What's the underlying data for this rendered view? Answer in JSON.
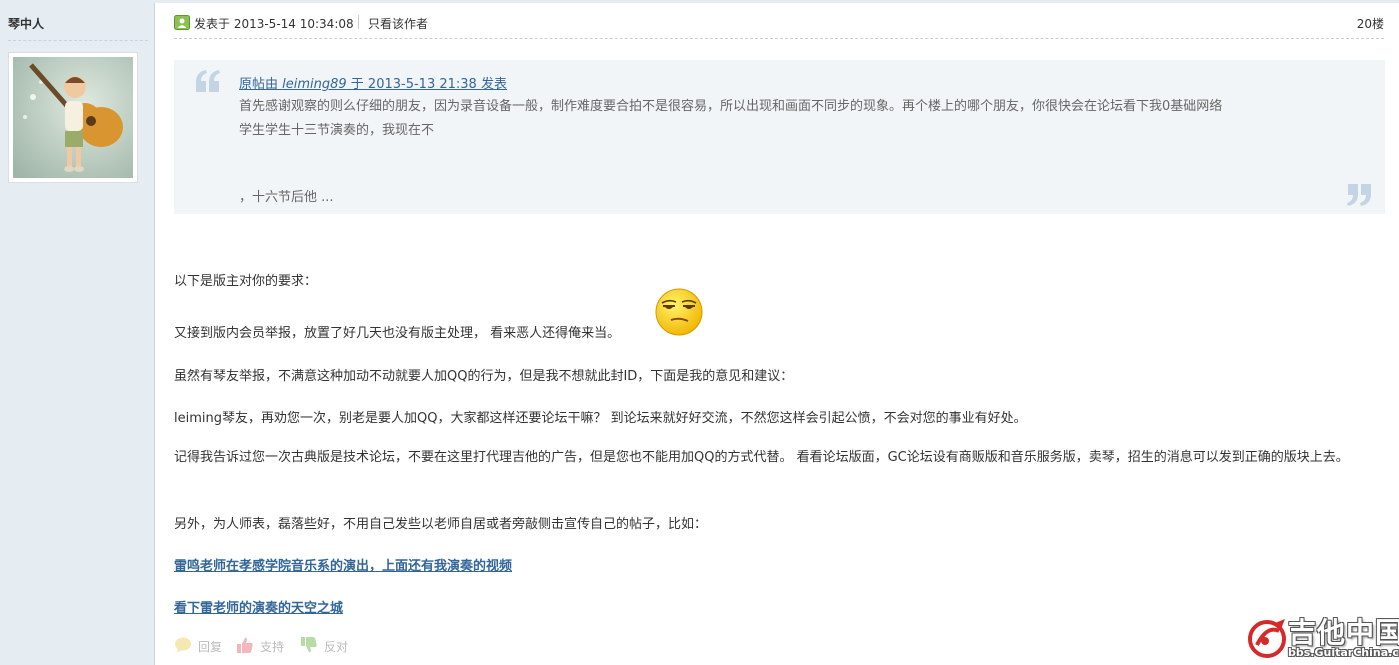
{
  "author": {
    "name": "琴中人",
    "avatar_icon": "guitar-boy-avatar"
  },
  "post_header": {
    "online_icon": "online-status-icon",
    "time": "发表于 2013-5-14 10:34:08",
    "only_author": "只看该作者",
    "floor": "20楼"
  },
  "quote": {
    "source_prefix": "原帖由 ",
    "source_author": "leiming89",
    "source_suffix": " 于 2013-5-13 21:38 发表",
    "line1": "首先感谢观察的则么仔细的朋友，因为录音设备一般，制作难度要合拍不是很容易，所以出现和画面不同步的现象。再个楼上的哪个朋友，你很快会在论坛看下我0基础网络",
    "line2": "学生学生十三节演奏的，我现在不",
    "line3": "，十六节后他 ..."
  },
  "content": {
    "p1": "以下是版主对你的要求：",
    "p2": "又接到版内会员举报，放置了好几天也没有版主处理， 看来恶人还得俺来当。",
    "p3": "虽然有琴友举报，不满意这种加动不动就要人加QQ的行为，但是我不想就此封ID，下面是我的意见和建议：",
    "p4": "leiming琴友，再劝您一次，别老是要人加QQ，大家都这样还要论坛干嘛？ 到论坛来就好好交流，不然您这样会引起公愤，不会对您的事业有好处。",
    "p5": "记得我告诉过您一次古典版是技术论坛，不要在这里打代理吉他的广告，但是您也不能用加QQ的方式代替。 看看论坛版面，GC论坛设有商贩版和音乐服务版，卖琴，招生的消息可以发到正确的版块上去。",
    "p6": "另外，为人师表，磊落些好，不用自己发些以老师自居或者旁敲侧击宣传自己的帖子，比如：",
    "link1": "雷鸣老师在孝感学院音乐系的演出，上面还有我演奏的视频",
    "link2": "看下雷老师的演奏的天空之城",
    "emoji_icon": "smug-face-emoji"
  },
  "actions": {
    "reply": "回复",
    "support": "支持",
    "oppose": "反对"
  },
  "watermark": {
    "site_name": "吉他中国",
    "url": "bbs.GuitarChina.com"
  },
  "colors": {
    "sidebar_bg": "#e5edf2",
    "link": "#336699",
    "quote_bg": "#f2f5f7",
    "text": "#333333"
  }
}
